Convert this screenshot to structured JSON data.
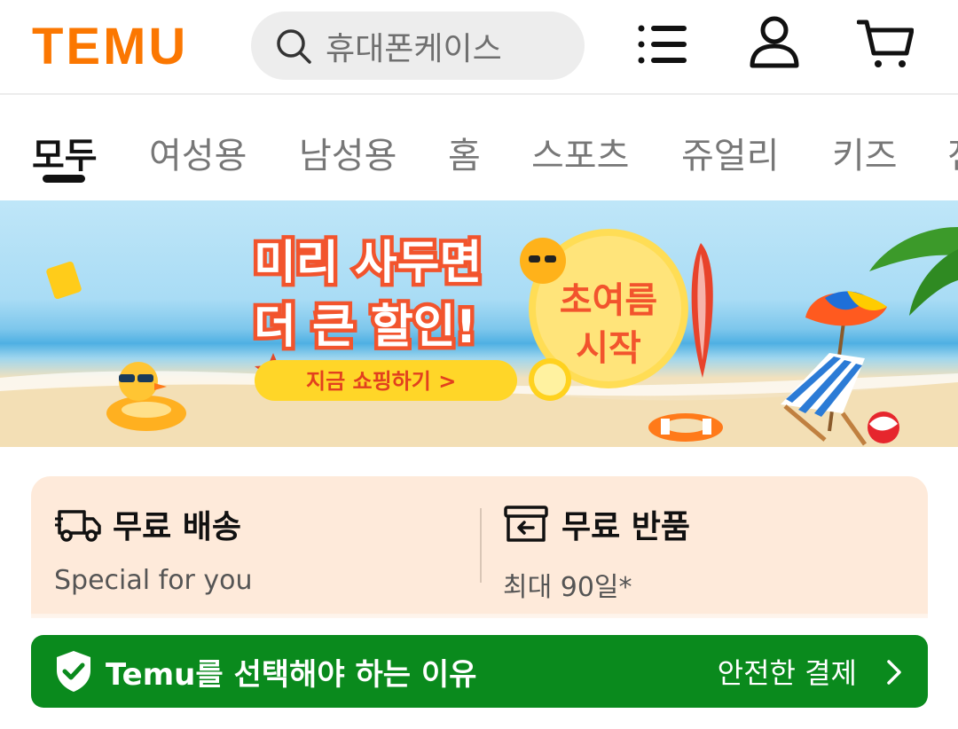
{
  "header": {
    "logo": "TEMU",
    "search_placeholder": "휴대폰케이스",
    "icons": [
      "search-icon",
      "menu-list-icon",
      "account-icon",
      "cart-icon"
    ]
  },
  "tabs": [
    {
      "label": "모두",
      "active": true
    },
    {
      "label": "여성용",
      "active": false
    },
    {
      "label": "남성용",
      "active": false
    },
    {
      "label": "홈",
      "active": false
    },
    {
      "label": "스포츠",
      "active": false
    },
    {
      "label": "쥬얼리",
      "active": false
    },
    {
      "label": "키즈",
      "active": false
    },
    {
      "label": "전",
      "active": false
    }
  ],
  "banner": {
    "headline_line1": "미리 사두면",
    "headline_line2": "더 큰 할인!",
    "cta": "지금 쇼핑하기 >",
    "badge_line1": "초여름",
    "badge_line2": "시작"
  },
  "benefits": [
    {
      "title": "무료 배송",
      "subtitle": "Special for you",
      "icon": "truck-icon"
    },
    {
      "title": "무료 반품",
      "subtitle": "최대 90일*",
      "icon": "return-box-icon"
    }
  ],
  "safe_bar": {
    "title": "Temu를 선택해야 하는 이유",
    "right_text": "안전한 결제",
    "icon": "shield-check-icon"
  },
  "colors": {
    "brand_orange": "#fb7701",
    "safe_green": "#0a8a1d",
    "benefit_bg": "#feeada"
  }
}
